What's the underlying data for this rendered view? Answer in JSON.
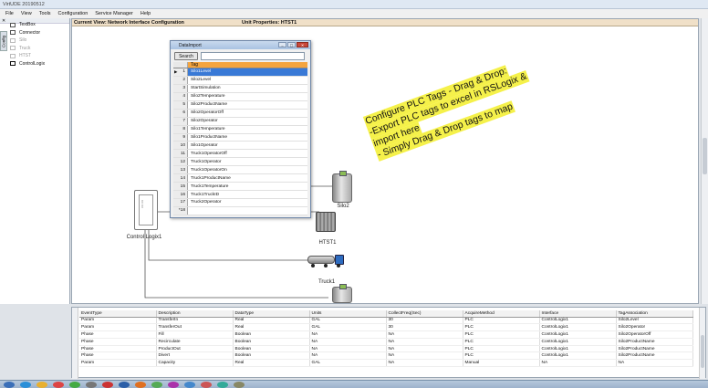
{
  "app": {
    "title": "VirtUDE 20190512"
  },
  "menu": [
    "File",
    "View",
    "Tools",
    "Configuration",
    "Service Manager",
    "Help"
  ],
  "toolbox": {
    "tab": "Config",
    "items": [
      {
        "label": "TextBox",
        "state": "normal"
      },
      {
        "label": "Connector",
        "state": "normal"
      },
      {
        "label": "Silo",
        "state": "disabled"
      },
      {
        "label": "Truck",
        "state": "disabled"
      },
      {
        "label": "HTST",
        "state": "disabled"
      },
      {
        "label": "ControlLogix",
        "state": "selected"
      }
    ]
  },
  "canvas": {
    "current_view": "Current View: Network Interface Configuration",
    "unit_properties": "Unit Properties: HTST1",
    "labels": {
      "plc": "Control Logix1",
      "silo2": "Silo2",
      "htst1": "HTST1",
      "truck1": "Truck1"
    }
  },
  "dialog": {
    "title": "DataImport",
    "search_label": "Search",
    "search_value": "",
    "column": "Tag",
    "rows": [
      {
        "n": "1",
        "tag": "Silo1Level"
      },
      {
        "n": "2",
        "tag": "Silo2Level"
      },
      {
        "n": "3",
        "tag": "StartSimulation"
      },
      {
        "n": "4",
        "tag": "Silo2Temperature"
      },
      {
        "n": "5",
        "tag": "Silo2ProductName"
      },
      {
        "n": "6",
        "tag": "Silo2OperatorOff"
      },
      {
        "n": "7",
        "tag": "Silo2Operator"
      },
      {
        "n": "8",
        "tag": "Silo1Temperature"
      },
      {
        "n": "9",
        "tag": "Silo1ProductName"
      },
      {
        "n": "10",
        "tag": "Silo1Operator"
      },
      {
        "n": "11",
        "tag": "Truck1OperatorOff"
      },
      {
        "n": "12",
        "tag": "Truck1Operator"
      },
      {
        "n": "13",
        "tag": "Truck1OperatorOn"
      },
      {
        "n": "14",
        "tag": "Truck1ProductName"
      },
      {
        "n": "15",
        "tag": "Truck1Temperature"
      },
      {
        "n": "16",
        "tag": "Truck1TruckID"
      },
      {
        "n": "17",
        "tag": "Truck2Operator"
      },
      {
        "n": "*18",
        "tag": ""
      }
    ]
  },
  "note": {
    "lines": [
      "Configure PLC Tags - Drag & Drop:",
      "-Export PLC tags to excel in RSLogix &",
      "import here",
      "- Simply Drag & Drop tags to map"
    ]
  },
  "events": {
    "headers": [
      "EventType",
      "Description",
      "DataType",
      "Units",
      "CollectFreq(Sec)",
      "AcquireMethod",
      "Interface",
      "TagAssociation"
    ],
    "rows": [
      [
        "Param",
        "TransferIn",
        "Real",
        "GAL",
        "30",
        "PLC",
        "ControlLogix1",
        "Silo2Level"
      ],
      [
        "Param",
        "TransferOut",
        "Real",
        "GAL",
        "30",
        "PLC",
        "ControlLogix1",
        "Silo2Operator"
      ],
      [
        "Phase",
        "Fill",
        "Boolean",
        "NA",
        "NA",
        "PLC",
        "ControlLogix1",
        "Silo2OperatorOff"
      ],
      [
        "Phase",
        "Recirculate",
        "Boolean",
        "NA",
        "NA",
        "PLC",
        "ControlLogix1",
        "Silo2ProductName"
      ],
      [
        "Phase",
        "ProductOut",
        "Boolean",
        "NA",
        "NA",
        "PLC",
        "ControlLogix1",
        "Silo2ProductName"
      ],
      [
        "Phase",
        "Divert",
        "Boolean",
        "NA",
        "NA",
        "PLC",
        "ControlLogix1",
        "Silo2ProductName"
      ],
      [
        "Param",
        "Capacity",
        "Real",
        "GAL",
        "NA",
        "Manual",
        "NA",
        "NA"
      ]
    ]
  },
  "colors": {
    "accent_header": "#f4a43e",
    "selected_row": "#3979d6",
    "note_highlight": "#f5f14a",
    "view_header": "#f0e0c8"
  }
}
